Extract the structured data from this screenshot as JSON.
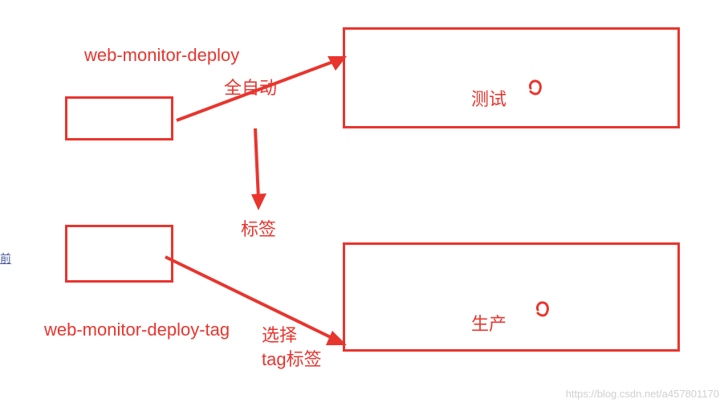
{
  "labels": {
    "top_source": "web-monitor-deploy",
    "bottom_source": "web-monitor-deploy-tag",
    "auto": "全自动",
    "tag": "标签",
    "select_tag_line1": "选择",
    "select_tag_line2": "tag标签"
  },
  "boxes": {
    "test": "测试",
    "prod": "生产"
  },
  "link": "前",
  "watermark": "https://blog.csdn.net/a457801170",
  "colors": {
    "red": "#e8352e"
  }
}
